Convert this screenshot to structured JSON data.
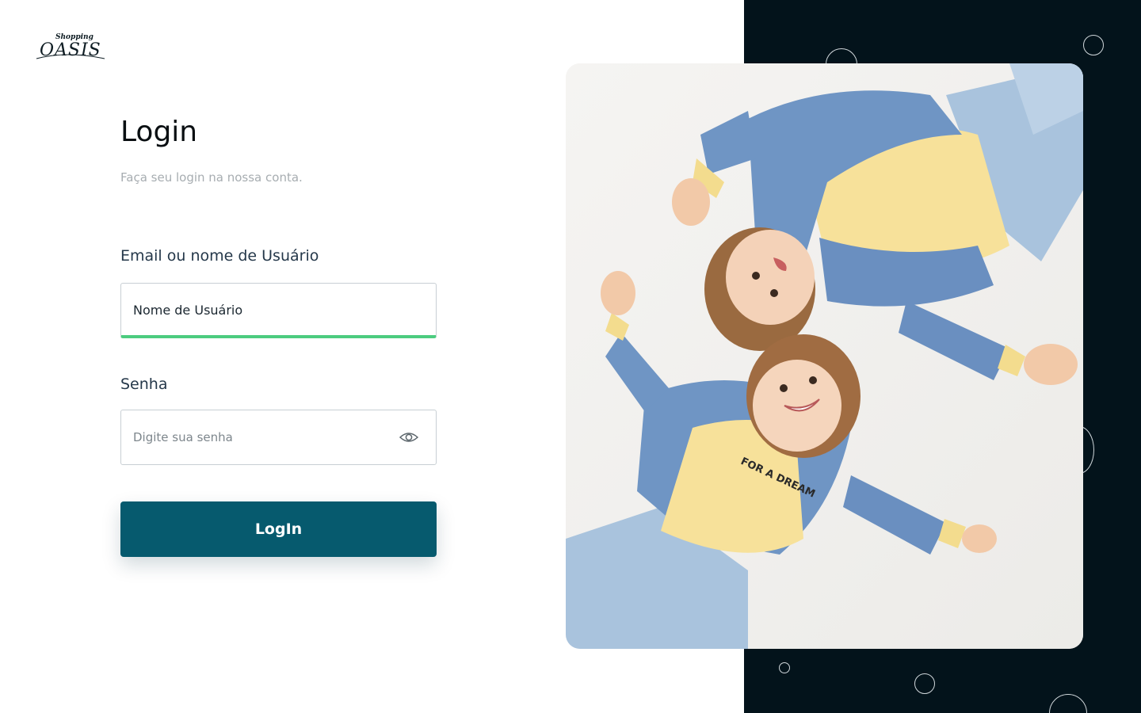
{
  "brand": {
    "small": "Shopping",
    "name": "OASIS"
  },
  "login": {
    "title": "Login",
    "subtitle": "Faça seu login na nossa conta.",
    "email_label": "Email ou nome de Usuário",
    "username_value": "Nome de Usuário",
    "password_label": "Senha",
    "password_placeholder": "Digite sua senha",
    "submit_label": "LogIn"
  },
  "photo": {
    "shirt_text": "FOR A DREAM"
  },
  "icons": {
    "password_toggle": "eye-icon"
  },
  "colors": {
    "primary_button": "#065a6e",
    "focus_underline": "#4ccc7f",
    "dark_panel": "#03131b"
  }
}
